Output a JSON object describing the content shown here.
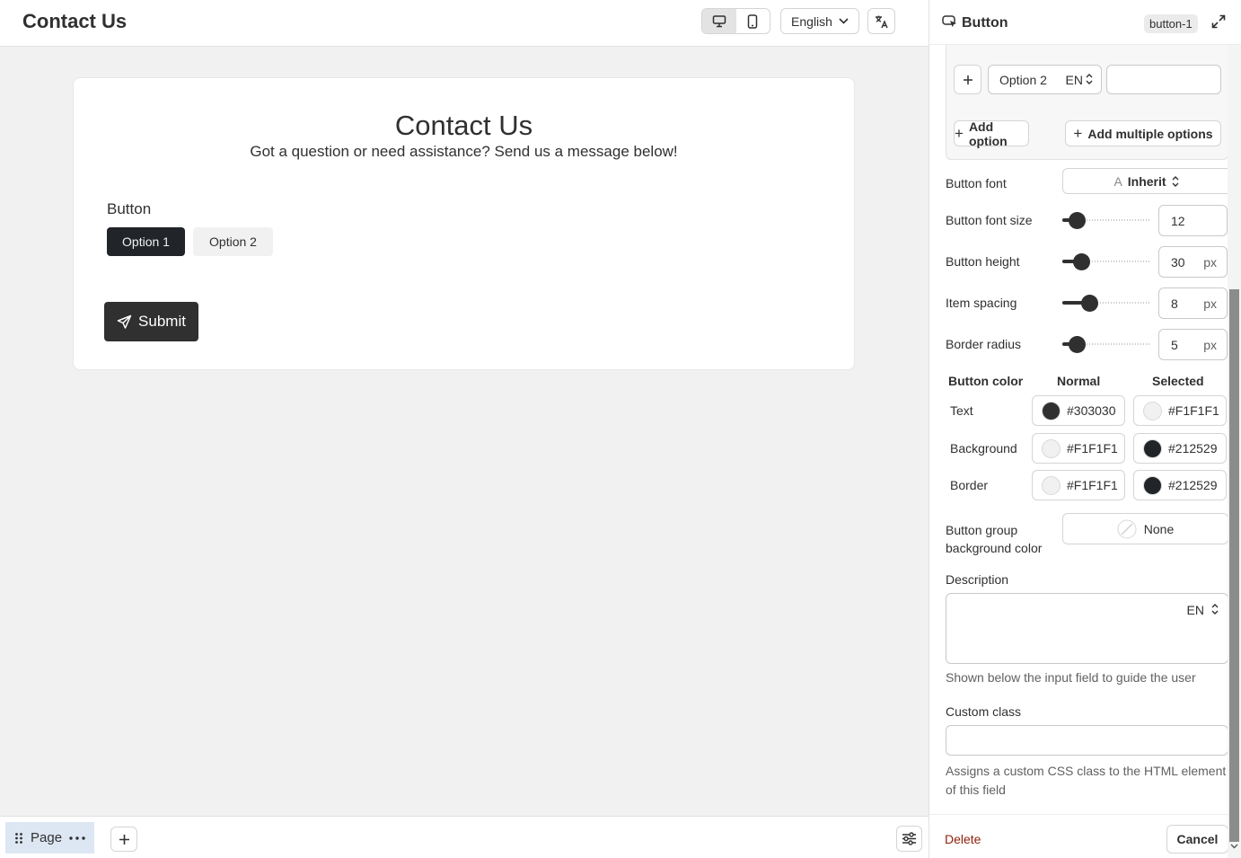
{
  "header": {
    "title": "Contact Us",
    "language": "English"
  },
  "form": {
    "title": "Contact Us",
    "subtitle": "Got a question or need assistance? Send us a message below!",
    "field_label": "Button",
    "options": [
      "Option 1",
      "Option 2"
    ],
    "selected_option": "Option 1",
    "submit_label": "Submit"
  },
  "bottom": {
    "page_label": "Page"
  },
  "panel": {
    "title": "Button",
    "badge": "button-1",
    "option_row": {
      "value": "Option 2",
      "lang": "EN"
    },
    "add_option": "Add option",
    "add_multiple": "Add multiple options",
    "button_font_label": "Button font",
    "button_font_value": "Inherit",
    "settings": [
      {
        "label": "Button font size",
        "value": "12",
        "unit": "",
        "level": 0.17
      },
      {
        "label": "Button height",
        "value": "30",
        "unit": "px",
        "level": 0.22
      },
      {
        "label": "Item spacing",
        "value": "8",
        "unit": "px",
        "level": 0.31
      },
      {
        "label": "Border radius",
        "value": "5",
        "unit": "px",
        "level": 0.17
      }
    ],
    "colors": {
      "header_label": "Button color",
      "col_normal": "Normal",
      "col_selected": "Selected",
      "rows": [
        {
          "label": "Text",
          "normal": "#303030",
          "selected": "#F1F1F1"
        },
        {
          "label": "Background",
          "normal": "#F1F1F1",
          "selected": "#212529"
        },
        {
          "label": "Border",
          "normal": "#F1F1F1",
          "selected": "#212529"
        }
      ]
    },
    "group_bg_label": "Button group background color",
    "group_bg_value": "None",
    "description_label": "Description",
    "description_lang": "EN",
    "description_help": "Shown below the input field to guide the user",
    "custom_class_label": "Custom class",
    "custom_class_help": "Assigns a custom CSS class to the HTML element of this field",
    "delete_label": "Delete",
    "cancel_label": "Cancel"
  },
  "theme": {
    "dark": "#303030",
    "selected_bg": "#212529",
    "light": "#F1F1F1",
    "delete_color": "#8E1F0B",
    "page_chip_bg": "#DDE7F3"
  }
}
